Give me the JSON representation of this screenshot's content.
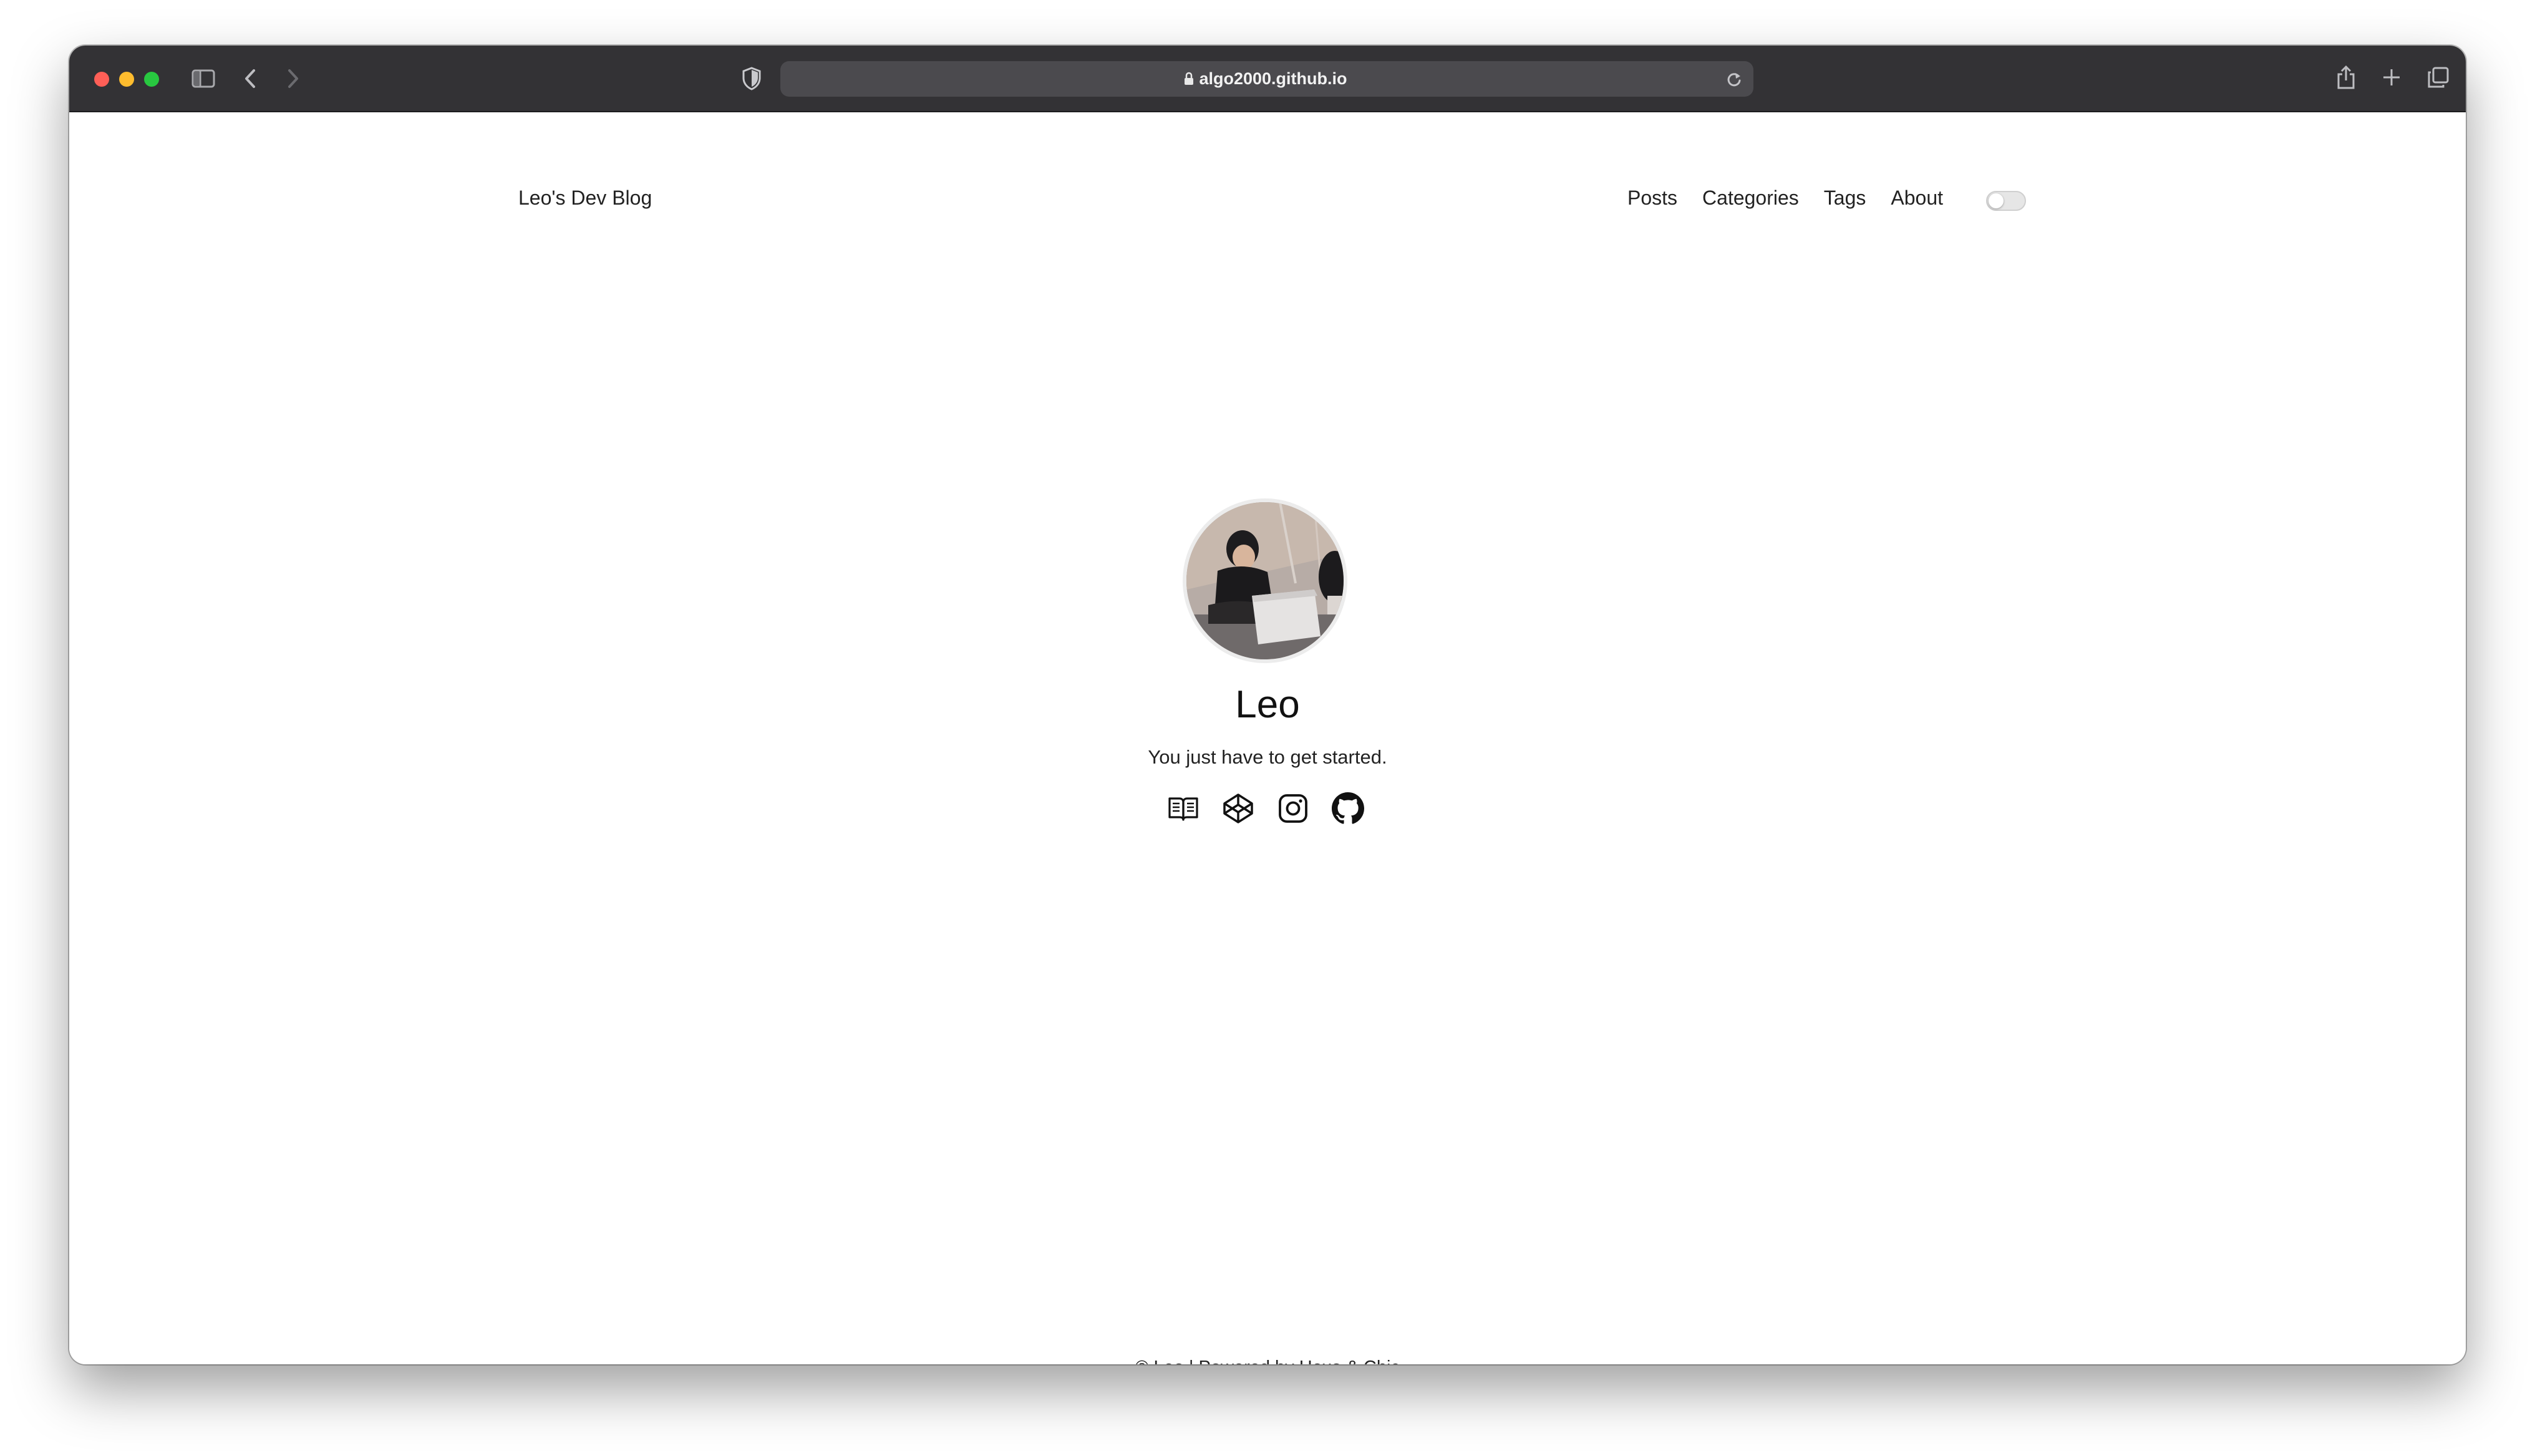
{
  "browser": {
    "url": "algo2000.github.io"
  },
  "site": {
    "brand": "Leo's Dev Blog",
    "nav": [
      "Posts",
      "Categories",
      "Tags",
      "About"
    ]
  },
  "profile": {
    "name": "Leo",
    "tagline": "You just have to get started."
  },
  "social_icons": [
    "book-icon",
    "codepen-icon",
    "instagram-icon",
    "github-icon"
  ],
  "footer": {
    "copyright": "© Leo",
    "separator": "|",
    "powered_by": "Powered by",
    "hexo": "Hexo",
    "amp": "&",
    "chic": "Chic"
  },
  "colors": {
    "toolbar": "#333235",
    "close": "#ff5f57",
    "minimize": "#febc2e",
    "maximize": "#28c840"
  }
}
